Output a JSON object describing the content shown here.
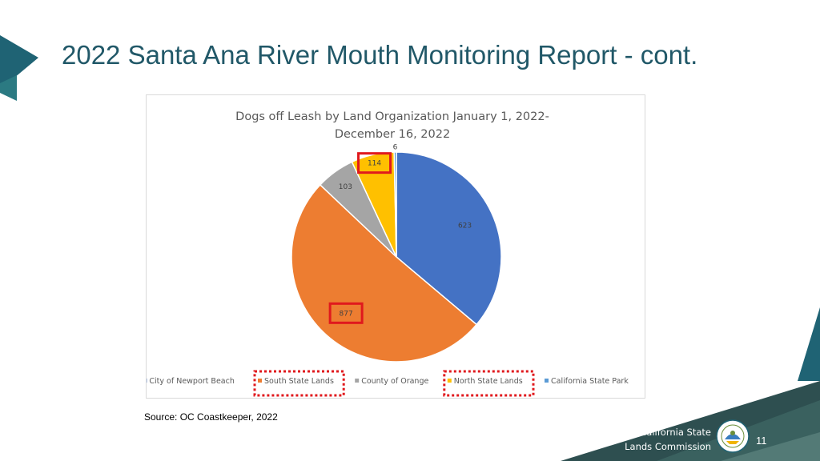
{
  "slide": {
    "title": "2022 Santa Ana River Mouth Monitoring Report - cont.",
    "source": "Source: OC Coastkeeper, 2022",
    "footer_line1": "California State",
    "footer_line2": "Lands Commission",
    "page_number": "11"
  },
  "colors": {
    "title": "#215868",
    "accent_teal": "#1f6374",
    "highlight_box": "#e0191d"
  },
  "icons": [
    "seal-icon"
  ],
  "chart_data": {
    "type": "pie",
    "title_lines": [
      "Dogs off Leash by Land Organization January 1, 2022-",
      "December 16, 2022"
    ],
    "categories": [
      "City of Newport Beach",
      "South State Lands",
      "County of Orange",
      "North State Lands",
      "California State Park"
    ],
    "values": [
      623,
      877,
      103,
      114,
      6
    ],
    "colors": [
      "#4472c4",
      "#ed7d31",
      "#a5a5a5",
      "#ffc000",
      "#5b9bd5"
    ],
    "legend": "bottom",
    "highlighted": [
      "South State Lands",
      "North State Lands"
    ]
  }
}
